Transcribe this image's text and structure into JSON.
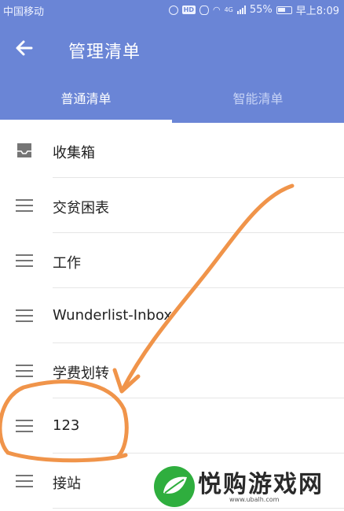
{
  "status_bar": {
    "carrier": "中国移动",
    "battery": "55%",
    "time": "早上8:09",
    "network": "4G",
    "hd": "HD"
  },
  "header": {
    "title": "管理清单",
    "back_icon": "arrow-left-icon"
  },
  "tabs": [
    {
      "label": "普通清单",
      "active": true
    },
    {
      "label": "智能清单",
      "active": false
    }
  ],
  "lists": [
    {
      "label": "收集箱",
      "icon": "inbox-icon"
    },
    {
      "label": "交贫困表",
      "icon": "drag-handle-icon"
    },
    {
      "label": "工作",
      "icon": "drag-handle-icon"
    },
    {
      "label": "Wunderlist-Inbox",
      "icon": "drag-handle-icon"
    },
    {
      "label": "学费划转",
      "icon": "drag-handle-icon"
    },
    {
      "label": "123",
      "icon": "drag-handle-icon"
    },
    {
      "label": "接站",
      "icon": "drag-handle-icon"
    }
  ],
  "watermark": {
    "text": "悦购游戏网",
    "url": "www.ubalh.com"
  },
  "colors": {
    "primary": "#6a85d6",
    "annotation": "#f0944a",
    "logo_green": "#2fae3e"
  }
}
